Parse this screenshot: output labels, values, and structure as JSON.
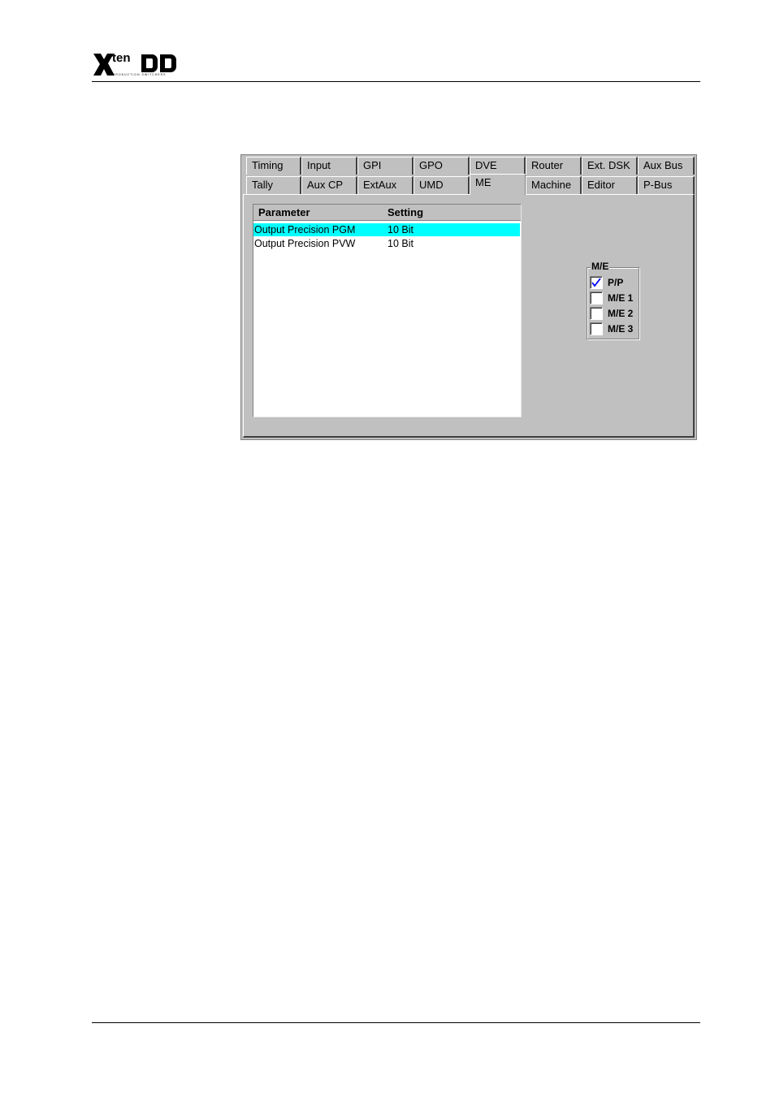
{
  "header": {
    "logo_text": "XtenDD",
    "logo_tagline": "PRODUCTION SWITCHERS"
  },
  "dialog": {
    "tabs_row1": [
      "Timing",
      "Input",
      "GPI",
      "GPO",
      "DVE",
      "Router",
      "Ext. DSK",
      "Aux Bus"
    ],
    "tabs_row2": [
      "Tally",
      "Aux CP",
      "ExtAux",
      "UMD",
      "ME",
      "Machine",
      "Editor",
      "P-Bus"
    ],
    "active_tab": "ME",
    "table": {
      "columns": [
        "Parameter",
        "Setting"
      ],
      "rows": [
        {
          "parameter": "Output Precision PGM",
          "setting": "10 Bit",
          "selected": true
        },
        {
          "parameter": "Output Precision PVW",
          "setting": "10 Bit",
          "selected": false
        }
      ]
    },
    "me_group": {
      "title": "M/E",
      "options": [
        {
          "label": "P/P",
          "checked": true
        },
        {
          "label": "M/E 1",
          "checked": false
        },
        {
          "label": "M/E 2",
          "checked": false
        },
        {
          "label": "M/E 3",
          "checked": false
        }
      ]
    }
  },
  "colors": {
    "dialog_bg": "#c0c0c0",
    "selection": "#00ffff",
    "check": "#0000ff"
  }
}
